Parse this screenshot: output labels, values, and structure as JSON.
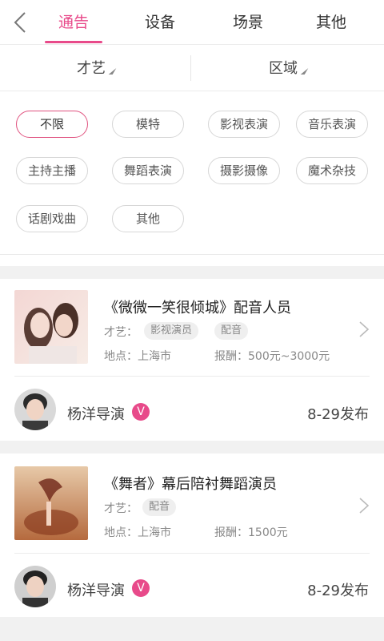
{
  "tabs": [
    {
      "label": "通告",
      "active": true
    },
    {
      "label": "设备",
      "active": false
    },
    {
      "label": "场景",
      "active": false
    },
    {
      "label": "其他",
      "active": false
    }
  ],
  "filters": [
    {
      "label": "才艺"
    },
    {
      "label": "区域"
    }
  ],
  "chips": [
    "不限",
    "模特",
    "影视表演",
    "音乐表演",
    "主持主播",
    "舞蹈表演",
    "摄影摄像",
    "魔术杂技",
    "话剧戏曲",
    "其他"
  ],
  "selected_chip": "不限",
  "accent_color": "#e84a8a",
  "cards": [
    {
      "title": "《微微一笑很倾城》配音人员",
      "skill_label": "才艺：",
      "skills": [
        "影视演员",
        "配音"
      ],
      "location": "地点：上海市",
      "pay": "报酬：500元~3000元",
      "poster": "杨洋导演",
      "verified": "V",
      "date": "8-29发布",
      "thumb_caption": "微微一笑很倾城"
    },
    {
      "title": "《舞者》幕后陪衬舞蹈演员",
      "skill_label": "才艺：",
      "skills": [
        "配音"
      ],
      "location": "地点：上海市",
      "pay": "报酬：1500元",
      "poster": "杨洋导演",
      "verified": "V",
      "date": "8-29发布",
      "thumb_caption": "舞者"
    }
  ],
  "icons": {
    "back": "back-chevron-icon",
    "caret": "caret-icon",
    "chevron": "chevron-right-icon",
    "verified": "verified-v-icon"
  }
}
